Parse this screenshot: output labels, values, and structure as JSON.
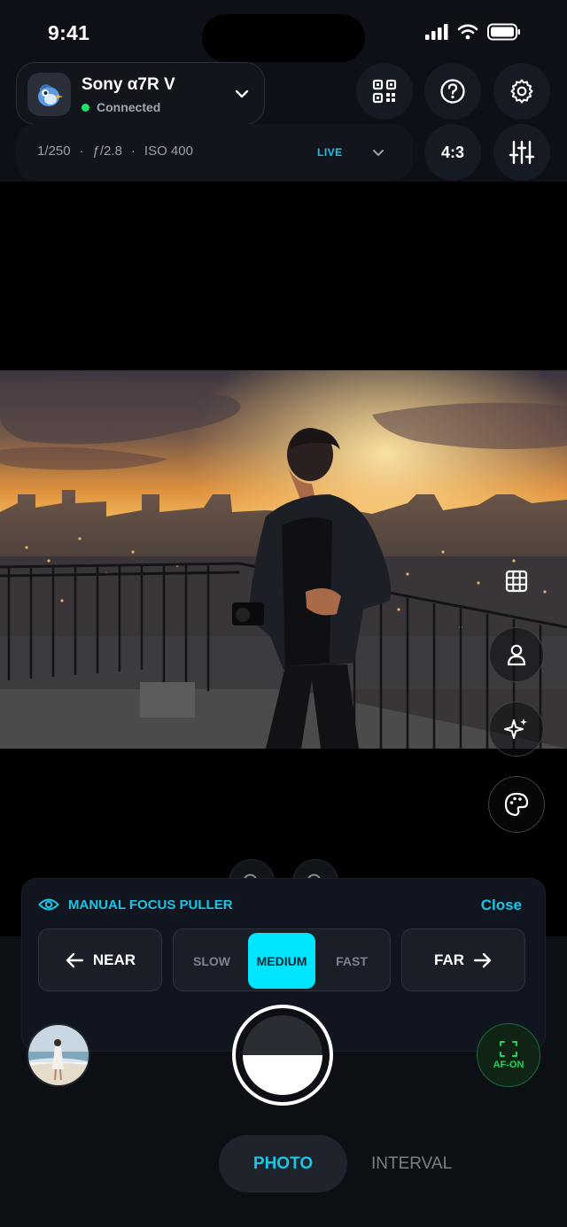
{
  "status_bar": {
    "time": "9:41",
    "icons": [
      "signal-icon",
      "wifi-icon",
      "battery-icon"
    ]
  },
  "camera": {
    "name": "Sony α7R V",
    "status": "Connected",
    "status_color": "#1ee36b",
    "avatar_icon": "bird-mascot-icon"
  },
  "header_actions": [
    "qr-code-icon",
    "help-icon",
    "gear-icon"
  ],
  "exposure": {
    "shutter": "1/250",
    "separator": "·",
    "aperture": "ƒ/2.8",
    "iso": "ISO 400",
    "live_label": "LIVE",
    "aspect_ratio": "4:3"
  },
  "side_tools": [
    "grid-icon",
    "person-icon",
    "sparkles-icon",
    "palette-icon"
  ],
  "zoom_controls": [
    "zoom-out-icon",
    "zoom-in-icon"
  ],
  "focus_puller": {
    "title": "MANUAL FOCUS PULLER",
    "close_label": "Close",
    "near_label": "NEAR",
    "far_label": "FAR",
    "speeds": [
      "SLOW",
      "MEDIUM",
      "FAST"
    ],
    "selected_speed": "MEDIUM"
  },
  "capture": {
    "af_label": "AF-ON"
  },
  "modes": {
    "photo": "PHOTO",
    "interval": "INTERVAL",
    "selected": "PHOTO"
  },
  "colors": {
    "accent": "#19c6e6",
    "highlight": "#00e5ff",
    "af_green": "#22d35e"
  }
}
